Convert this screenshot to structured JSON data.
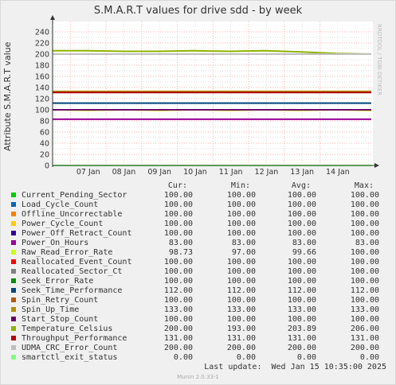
{
  "title": "S.M.A.R.T values for drive sdd - by week",
  "ylabel": "Attribute S.M.A.R.T value",
  "vendor": "RRDTOOL / TOBI OETIKER",
  "colors": {
    "plot_bg": "#ffffff",
    "page_bg": "#f0f0f0",
    "grid_major": "#ffb0b0",
    "grid_minor": "#e0e0e0",
    "axis": "#333333"
  },
  "chart_data": {
    "type": "line",
    "title": "S.M.A.R.T values for drive sdd - by week",
    "ylabel": "Attribute S.M.A.R.T value",
    "xlabel": "",
    "ylim": [
      0,
      250
    ],
    "yticks": [
      0,
      20,
      40,
      60,
      80,
      100,
      120,
      140,
      160,
      180,
      200,
      220,
      240
    ],
    "ytick_labels": [
      "0",
      "20",
      "40",
      "60",
      "80",
      "100",
      "120",
      "140",
      "160",
      "180",
      "200",
      "220",
      "240"
    ],
    "xlim": [
      "2025-01-06 12:00",
      "2025-01-15 10:35"
    ],
    "xticks": [
      "2025-01-07",
      "2025-01-08",
      "2025-01-09",
      "2025-01-10",
      "2025-01-11",
      "2025-01-12",
      "2025-01-13",
      "2025-01-14"
    ],
    "xtick_labels": [
      "07 Jan",
      "08 Jan",
      "09 Jan",
      "10 Jan",
      "11 Jan",
      "12 Jan",
      "13 Jan",
      "14 Jan"
    ],
    "grid": true,
    "series": [
      {
        "name": "Current_Pending_Sector",
        "color": "#00cc00",
        "values": [
          100,
          100,
          100,
          100,
          100,
          100,
          100,
          100,
          100,
          100
        ]
      },
      {
        "name": "Load_Cycle_Count",
        "color": "#0066b3",
        "values": [
          100,
          100,
          100,
          100,
          100,
          100,
          100,
          100,
          100,
          100
        ]
      },
      {
        "name": "Offline_Uncorrectable",
        "color": "#ff8000",
        "values": [
          100,
          100,
          100,
          100,
          100,
          100,
          100,
          100,
          100,
          100
        ]
      },
      {
        "name": "Power_Cycle_Count",
        "color": "#ffcc00",
        "values": [
          100,
          100,
          100,
          100,
          100,
          100,
          100,
          100,
          100,
          100
        ]
      },
      {
        "name": "Power_Off_Retract_Count",
        "color": "#330099",
        "values": [
          100,
          100,
          100,
          100,
          100,
          100,
          100,
          100,
          100,
          100
        ]
      },
      {
        "name": "Power_On_Hours",
        "color": "#990099",
        "values": [
          83,
          83,
          83,
          83,
          83,
          83,
          83,
          83,
          83,
          83
        ]
      },
      {
        "name": "Raw_Read_Error_Rate",
        "color": "#ccff00",
        "values": [
          100,
          99,
          100,
          99,
          100,
          99,
          100,
          99,
          100,
          98.73
        ]
      },
      {
        "name": "Reallocated_Event_Count",
        "color": "#ff0000",
        "values": [
          100,
          100,
          100,
          100,
          100,
          100,
          100,
          100,
          100,
          100
        ]
      },
      {
        "name": "Reallocated_Sector_Ct",
        "color": "#808080",
        "values": [
          100,
          100,
          100,
          100,
          100,
          100,
          100,
          100,
          100,
          100
        ]
      },
      {
        "name": "Seek_Error_Rate",
        "color": "#008f00",
        "values": [
          100,
          100,
          100,
          100,
          100,
          100,
          100,
          100,
          100,
          100
        ]
      },
      {
        "name": "Seek_Time_Performance",
        "color": "#00487d",
        "values": [
          112,
          112,
          112,
          112,
          112,
          112,
          112,
          112,
          112,
          112
        ]
      },
      {
        "name": "Spin_Retry_Count",
        "color": "#b35a00",
        "values": [
          100,
          100,
          100,
          100,
          100,
          100,
          100,
          100,
          100,
          100
        ]
      },
      {
        "name": "Spin_Up_Time",
        "color": "#b38f00",
        "values": [
          133,
          133,
          133,
          133,
          133,
          133,
          133,
          133,
          133,
          133
        ]
      },
      {
        "name": "Start_Stop_Count",
        "color": "#6b006b",
        "values": [
          100,
          100,
          100,
          100,
          100,
          100,
          100,
          100,
          100,
          100
        ]
      },
      {
        "name": "Temperature_Celsius",
        "color": "#8fb300",
        "values": [
          206,
          206,
          205,
          205,
          206,
          205,
          206,
          204,
          201,
          200
        ]
      },
      {
        "name": "Throughput_Performance",
        "color": "#b30000",
        "values": [
          131,
          131,
          131,
          131,
          131,
          131,
          131,
          131,
          131,
          131
        ]
      },
      {
        "name": "UDMA_CRC_Error_Count",
        "color": "#bebebe",
        "values": [
          200,
          200,
          200,
          200,
          200,
          200,
          200,
          200,
          200,
          200
        ]
      },
      {
        "name": "smartctl_exit_status",
        "color": "#80ff80",
        "values": [
          0,
          0,
          0,
          0,
          0,
          0,
          0,
          0,
          0,
          0
        ]
      }
    ]
  },
  "legend": {
    "headers": {
      "cur": "Cur:",
      "min": "Min:",
      "avg": "Avg:",
      "max": "Max:"
    },
    "rows": [
      {
        "name": "Current_Pending_Sector",
        "color": "#00cc00",
        "cur": "100.00",
        "min": "100.00",
        "avg": "100.00",
        "max": "100.00"
      },
      {
        "name": "Load_Cycle_Count",
        "color": "#0066b3",
        "cur": "100.00",
        "min": "100.00",
        "avg": "100.00",
        "max": "100.00"
      },
      {
        "name": "Offline_Uncorrectable",
        "color": "#ff8000",
        "cur": "100.00",
        "min": "100.00",
        "avg": "100.00",
        "max": "100.00"
      },
      {
        "name": "Power_Cycle_Count",
        "color": "#ffcc00",
        "cur": "100.00",
        "min": "100.00",
        "avg": "100.00",
        "max": "100.00"
      },
      {
        "name": "Power_Off_Retract_Count",
        "color": "#330099",
        "cur": "100.00",
        "min": "100.00",
        "avg": "100.00",
        "max": "100.00"
      },
      {
        "name": "Power_On_Hours",
        "color": "#990099",
        "cur": "83.00",
        "min": "83.00",
        "avg": "83.00",
        "max": "83.00"
      },
      {
        "name": "Raw_Read_Error_Rate",
        "color": "#ccff00",
        "cur": "98.73",
        "min": "97.00",
        "avg": "99.66",
        "max": "100.00"
      },
      {
        "name": "Reallocated_Event_Count",
        "color": "#ff0000",
        "cur": "100.00",
        "min": "100.00",
        "avg": "100.00",
        "max": "100.00"
      },
      {
        "name": "Reallocated_Sector_Ct",
        "color": "#808080",
        "cur": "100.00",
        "min": "100.00",
        "avg": "100.00",
        "max": "100.00"
      },
      {
        "name": "Seek_Error_Rate",
        "color": "#008f00",
        "cur": "100.00",
        "min": "100.00",
        "avg": "100.00",
        "max": "100.00"
      },
      {
        "name": "Seek_Time_Performance",
        "color": "#00487d",
        "cur": "112.00",
        "min": "112.00",
        "avg": "112.00",
        "max": "112.00"
      },
      {
        "name": "Spin_Retry_Count",
        "color": "#b35a00",
        "cur": "100.00",
        "min": "100.00",
        "avg": "100.00",
        "max": "100.00"
      },
      {
        "name": "Spin_Up_Time",
        "color": "#b38f00",
        "cur": "133.00",
        "min": "133.00",
        "avg": "133.00",
        "max": "133.00"
      },
      {
        "name": "Start_Stop_Count",
        "color": "#6b006b",
        "cur": "100.00",
        "min": "100.00",
        "avg": "100.00",
        "max": "100.00"
      },
      {
        "name": "Temperature_Celsius",
        "color": "#8fb300",
        "cur": "200.00",
        "min": "193.00",
        "avg": "203.89",
        "max": "206.00"
      },
      {
        "name": "Throughput_Performance",
        "color": "#b30000",
        "cur": "131.00",
        "min": "131.00",
        "avg": "131.00",
        "max": "131.00"
      },
      {
        "name": "UDMA_CRC_Error_Count",
        "color": "#bebebe",
        "cur": "200.00",
        "min": "200.00",
        "avg": "200.00",
        "max": "200.00"
      },
      {
        "name": "smartctl_exit_status",
        "color": "#80ff80",
        "cur": "0.00",
        "min": "0.00",
        "avg": "0.00",
        "max": "0.00"
      }
    ]
  },
  "last_update": "Last update:  Wed Jan 15 10:35:00 2025",
  "munin_version": "Munin 2.0.33-1"
}
